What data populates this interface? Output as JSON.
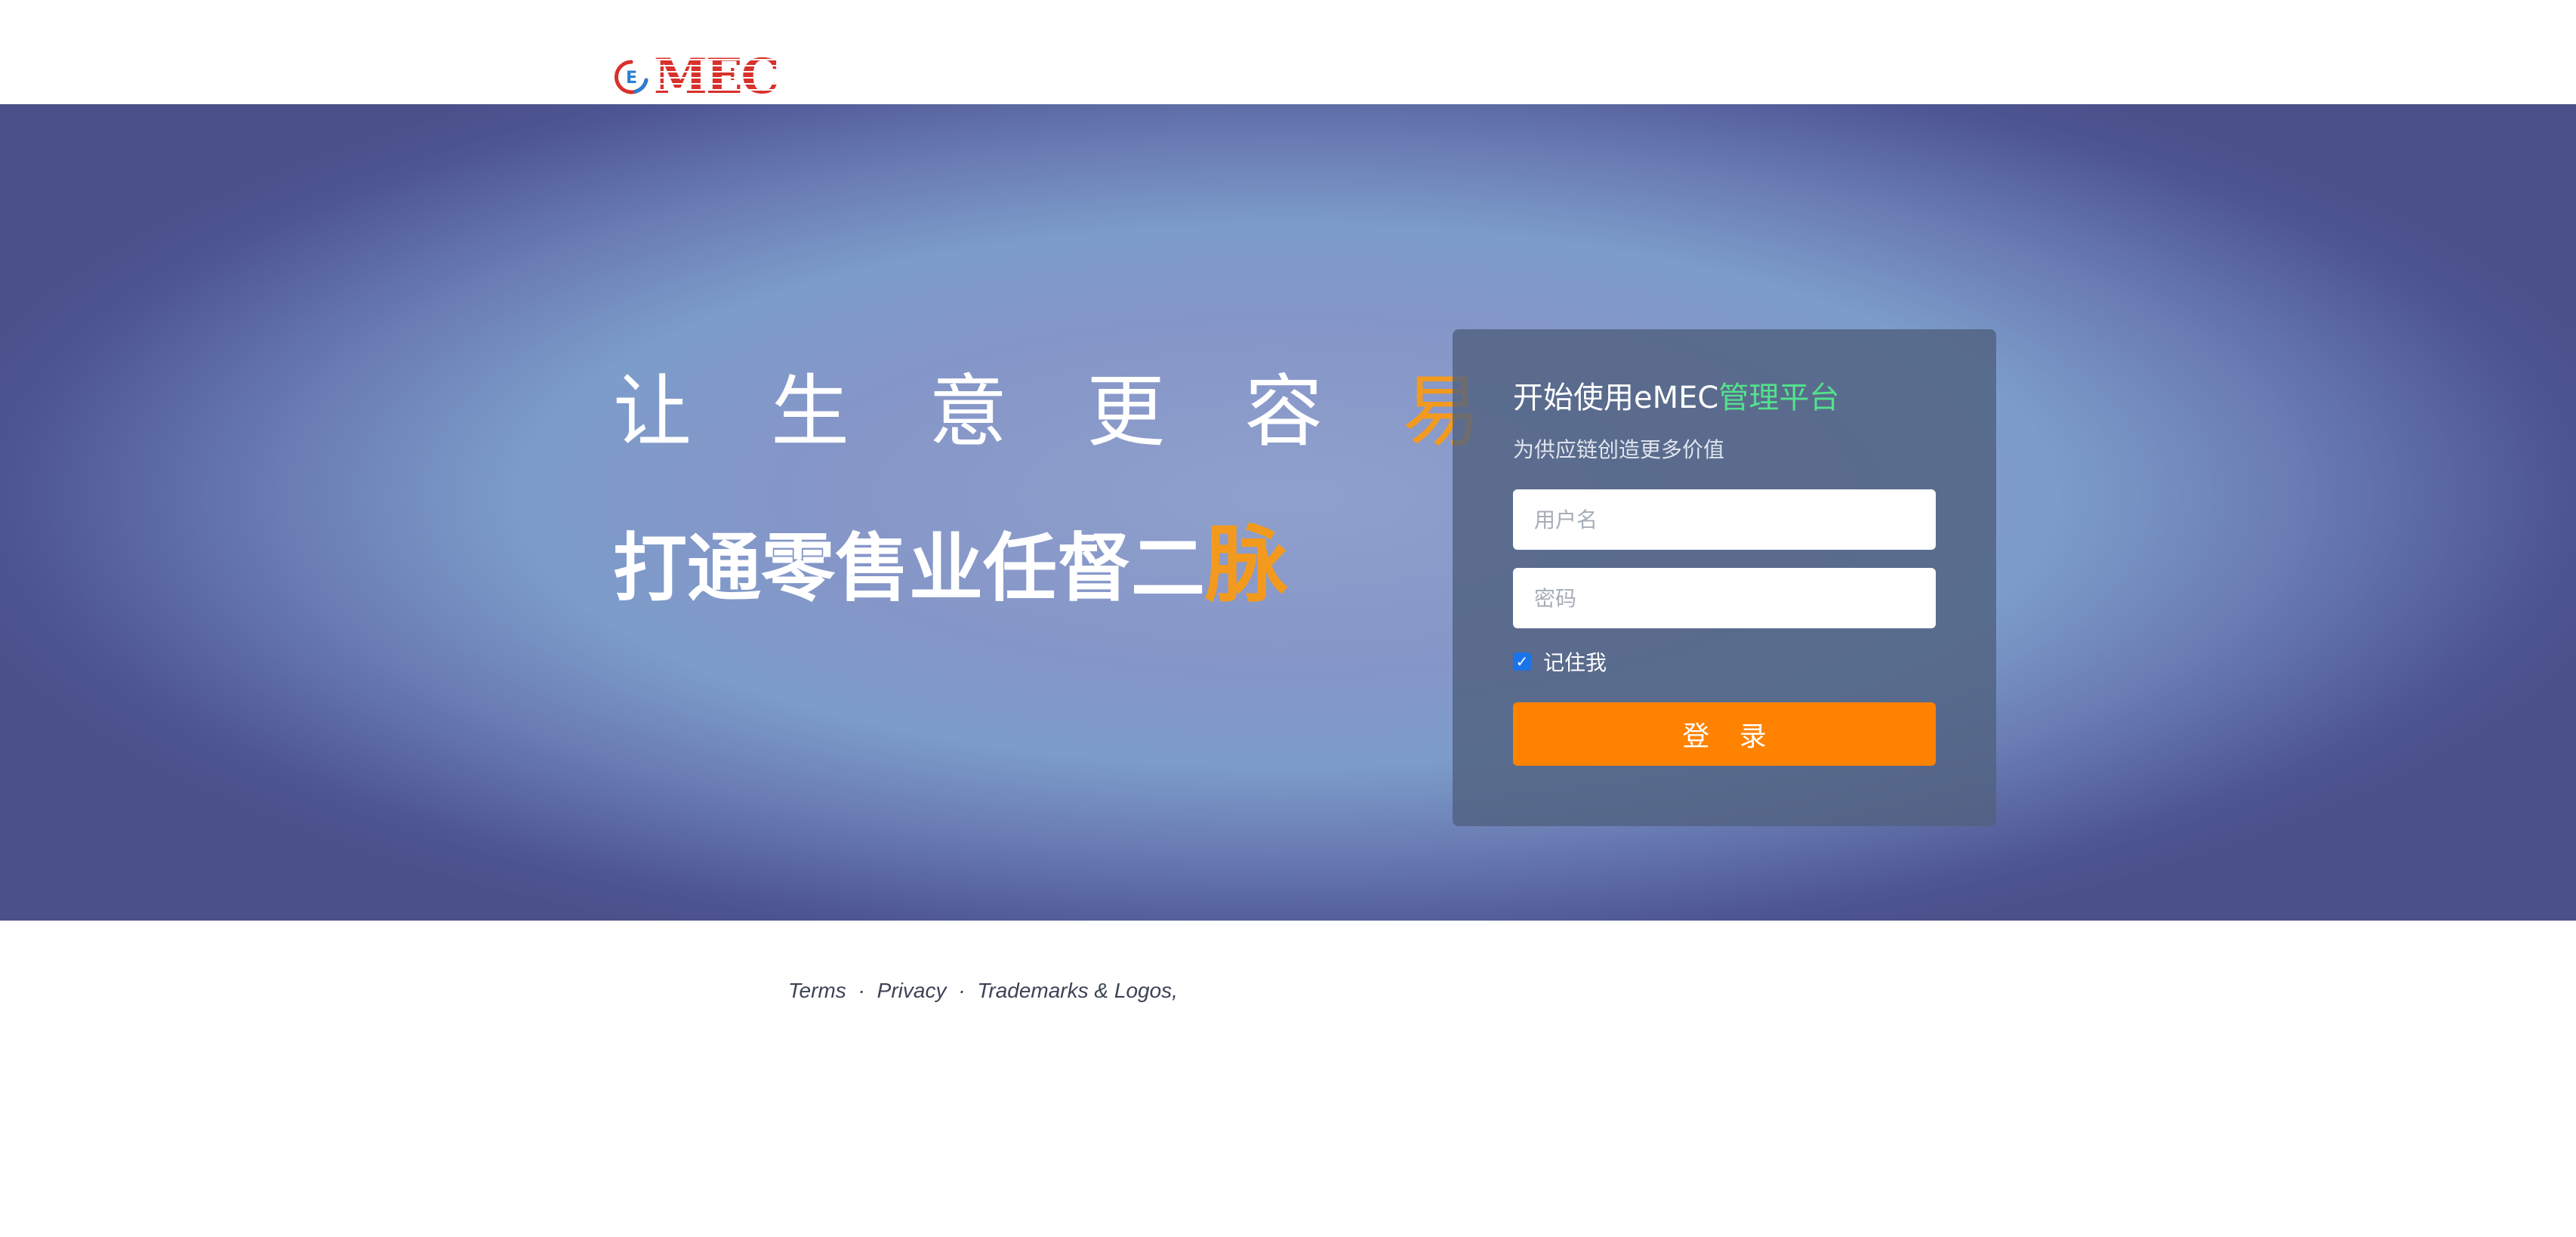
{
  "brand": {
    "logo_text": "MEC",
    "logo_colors": {
      "red": "#d9302b",
      "blue": "#2c7fd0"
    }
  },
  "hero": {
    "slogan_line1_main": "让 生 意 更 容",
    "slogan_line1_accent": "易",
    "slogan_line2_main": "打通零售业任督二",
    "slogan_line2_accent": "脉",
    "accent_color": "#f39a1e"
  },
  "login": {
    "title_main": "开始使用eMEC",
    "title_accent": "管理平台",
    "subtitle": "为供应链创造更多价值",
    "username_placeholder": "用户名",
    "password_placeholder": "密码",
    "remember_label": "记住我",
    "remember_checked": true,
    "submit_label": "登 录",
    "submit_color": "#ff8200",
    "title_accent_color": "#52e28c"
  },
  "footer": {
    "terms": "Terms",
    "separator": "·",
    "privacy": "Privacy",
    "trademarks": "Trademarks & Logos,"
  }
}
